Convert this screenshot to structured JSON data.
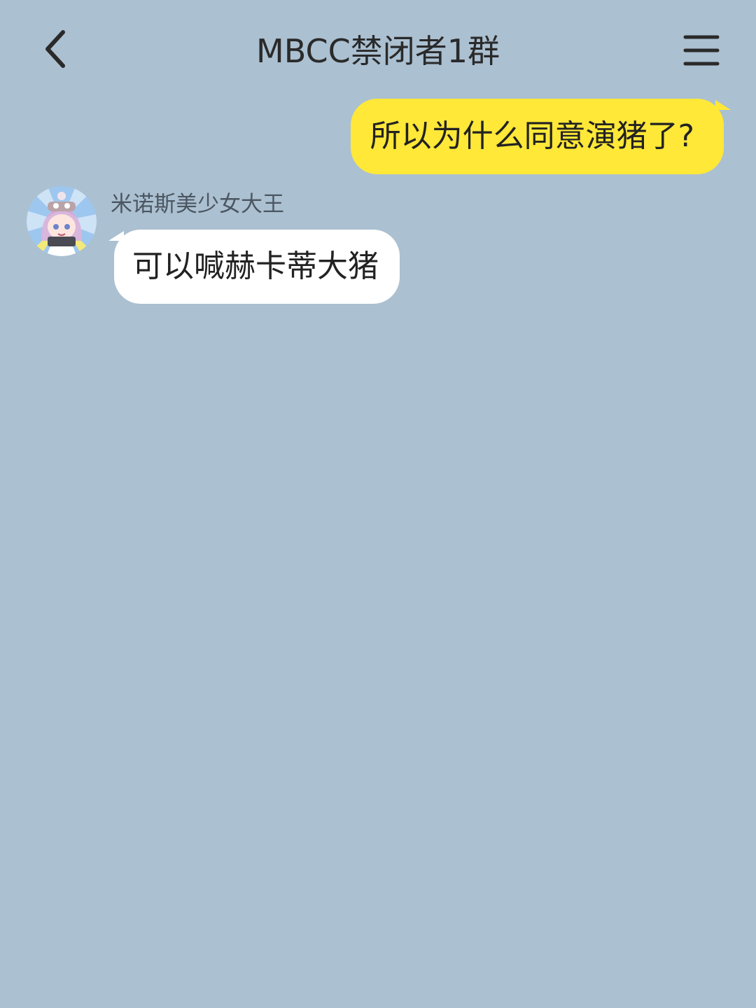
{
  "header": {
    "title": "MBCC禁闭者1群",
    "back_icon": "chevron-left-icon",
    "menu_icon": "hamburger-menu-icon"
  },
  "messages": [
    {
      "direction": "outgoing",
      "text": "所以为什么同意演猪了?"
    },
    {
      "direction": "incoming",
      "sender": "米诺斯美少女大王",
      "avatar": "anime-girl-avatar",
      "text": "可以喊赫卡蒂大猪"
    }
  ],
  "colors": {
    "background": "#abc0d1",
    "outgoing_bubble": "#ffe838",
    "incoming_bubble": "#ffffff"
  }
}
